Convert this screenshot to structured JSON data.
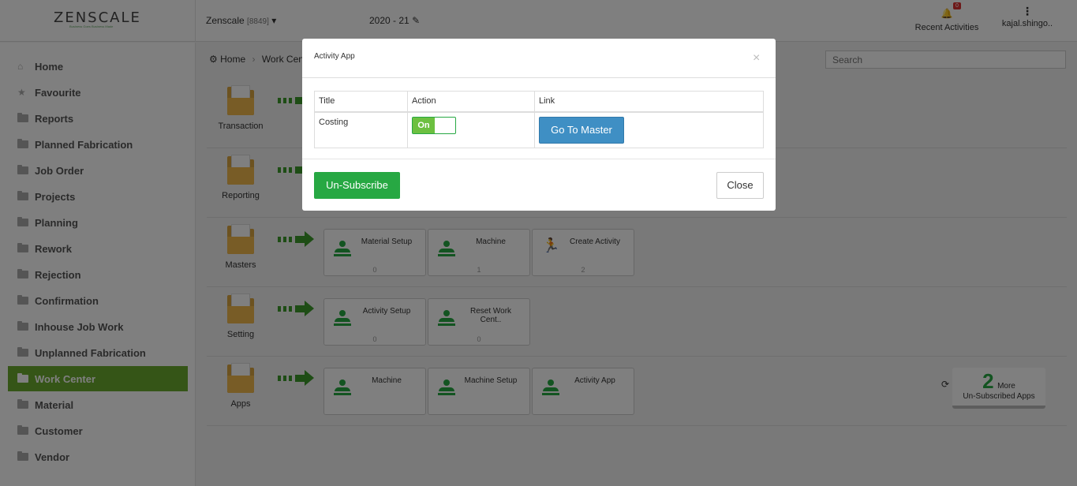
{
  "header": {
    "logo": "ZENSCALE",
    "logo_tagline": "Business Goes Business Made",
    "company": "Zenscale",
    "company_code": "[8849]",
    "fiscal_year": "2020 - 21",
    "notification_count": "0",
    "recent_activities": "Recent Activities",
    "user": "kajal.shingo.."
  },
  "sidebar": {
    "items": [
      {
        "label": "Home"
      },
      {
        "label": "Favourite"
      },
      {
        "label": "Reports"
      },
      {
        "label": "Planned Fabrication"
      },
      {
        "label": "Job Order"
      },
      {
        "label": "Projects"
      },
      {
        "label": "Planning"
      },
      {
        "label": "Rework"
      },
      {
        "label": "Rejection"
      },
      {
        "label": "Confirmation"
      },
      {
        "label": "Inhouse Job Work"
      },
      {
        "label": "Unplanned Fabrication"
      },
      {
        "label": "Work Center"
      },
      {
        "label": "Material"
      },
      {
        "label": "Customer"
      },
      {
        "label": "Vendor"
      }
    ],
    "active": "Work Center"
  },
  "breadcrumb": {
    "home": "Home",
    "current": "Work Cente"
  },
  "search": {
    "placeholder": "Search"
  },
  "rows": [
    {
      "label": "Transaction",
      "tiles": []
    },
    {
      "label": "Reporting",
      "tiles": []
    },
    {
      "label": "Masters",
      "tiles": [
        {
          "title": "Material Setup",
          "count": "0"
        },
        {
          "title": "Machine",
          "count": "1"
        },
        {
          "title": "Create Activity",
          "count": "2"
        }
      ]
    },
    {
      "label": "Setting",
      "tiles": [
        {
          "title": "Activity Setup",
          "count": "0"
        },
        {
          "title": "Reset Work Cent..",
          "count": "0"
        }
      ]
    },
    {
      "label": "Apps",
      "tiles": [
        {
          "title": "Machine",
          "count": ""
        },
        {
          "title": "Machine Setup",
          "count": ""
        },
        {
          "title": "Activity App",
          "count": ""
        }
      ]
    }
  ],
  "more_apps": {
    "count": "2",
    "more_label": "More",
    "sub_label": "Un-Subscribed Apps"
  },
  "modal": {
    "title": "Activity App",
    "columns": [
      "Title",
      "Action",
      "Link"
    ],
    "row": {
      "title": "Costing",
      "toggle_label": "On",
      "link_button": "Go To Master"
    },
    "unsubscribe_button": "Un-Subscribe",
    "close_button": "Close"
  },
  "colors": {
    "active_nav": "#6aab2f",
    "primary_green": "#27a843",
    "link_blue": "#3f8fc4",
    "folder": "#f0b94d"
  }
}
